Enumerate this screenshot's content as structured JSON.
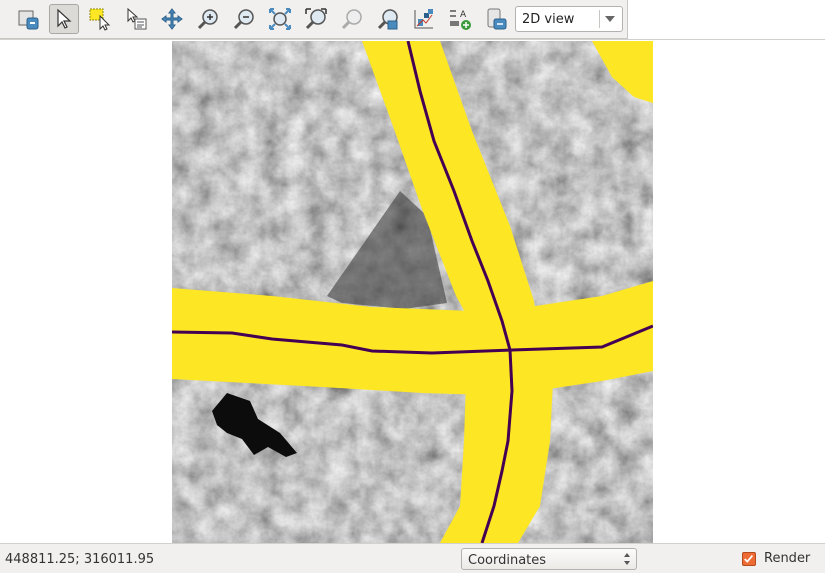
{
  "toolbar": {
    "tools": [
      {
        "name": "zoom-full-icon"
      },
      {
        "name": "pan-select-arrow-icon",
        "active": true
      },
      {
        "name": "select-features-icon"
      },
      {
        "name": "identify-icon"
      },
      {
        "name": "pan-icon"
      },
      {
        "name": "zoom-in-icon"
      },
      {
        "name": "zoom-out-icon"
      },
      {
        "name": "zoom-extent-icon"
      },
      {
        "name": "zoom-layer-icon"
      },
      {
        "name": "zoom-selection-icon"
      },
      {
        "name": "zoom-last-icon"
      },
      {
        "name": "map-theme-icon"
      },
      {
        "name": "label-icon"
      },
      {
        "name": "map-tips-icon"
      }
    ],
    "view_select": {
      "value": "2D view"
    }
  },
  "status": {
    "coordinates": "448811.25; 316011.95",
    "display_mode": "Coordinates",
    "render_label": "Render",
    "render_checked": true
  },
  "colors": {
    "road_fill": "#fde725",
    "road_center": "#440154",
    "render_checkbox": "#ee6c33"
  }
}
